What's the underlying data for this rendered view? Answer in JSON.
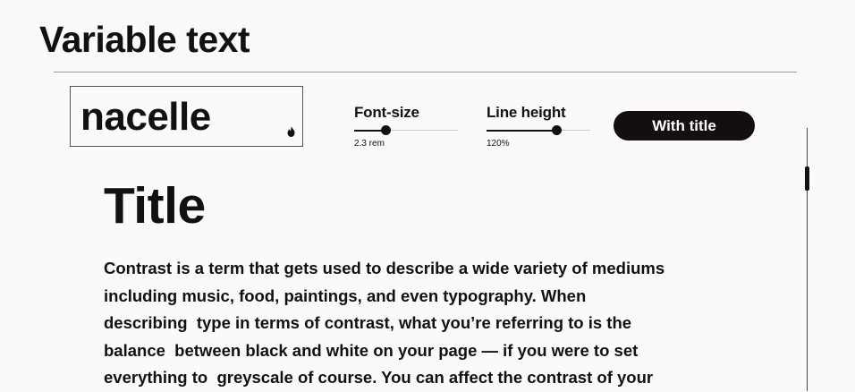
{
  "header": {
    "title": "Variable text"
  },
  "font_picker": {
    "font_name": "nacelle",
    "icon": "fire-icon"
  },
  "controls": {
    "font_size": {
      "label": "Font-size",
      "value": "2.3 rem",
      "level": 0.3
    },
    "line_height": {
      "label": "Line height",
      "value": "120%",
      "level": 0.67
    },
    "title_toggle": {
      "label": "With title"
    }
  },
  "preview": {
    "title": "Title",
    "lines": [
      "Contrast is a term that gets used to describe a wide variety of mediums",
      "including music, food, paintings, and even typography. When",
      "describing  type in terms of contrast, what you’re referring to is the",
      "balance  between black and white on your page — if you were to set",
      "everything to  greyscale of course. You can affect the contrast of your"
    ]
  },
  "colors": {
    "background": "#fbfaf8",
    "text": "#111111",
    "button": "#130f0e"
  }
}
